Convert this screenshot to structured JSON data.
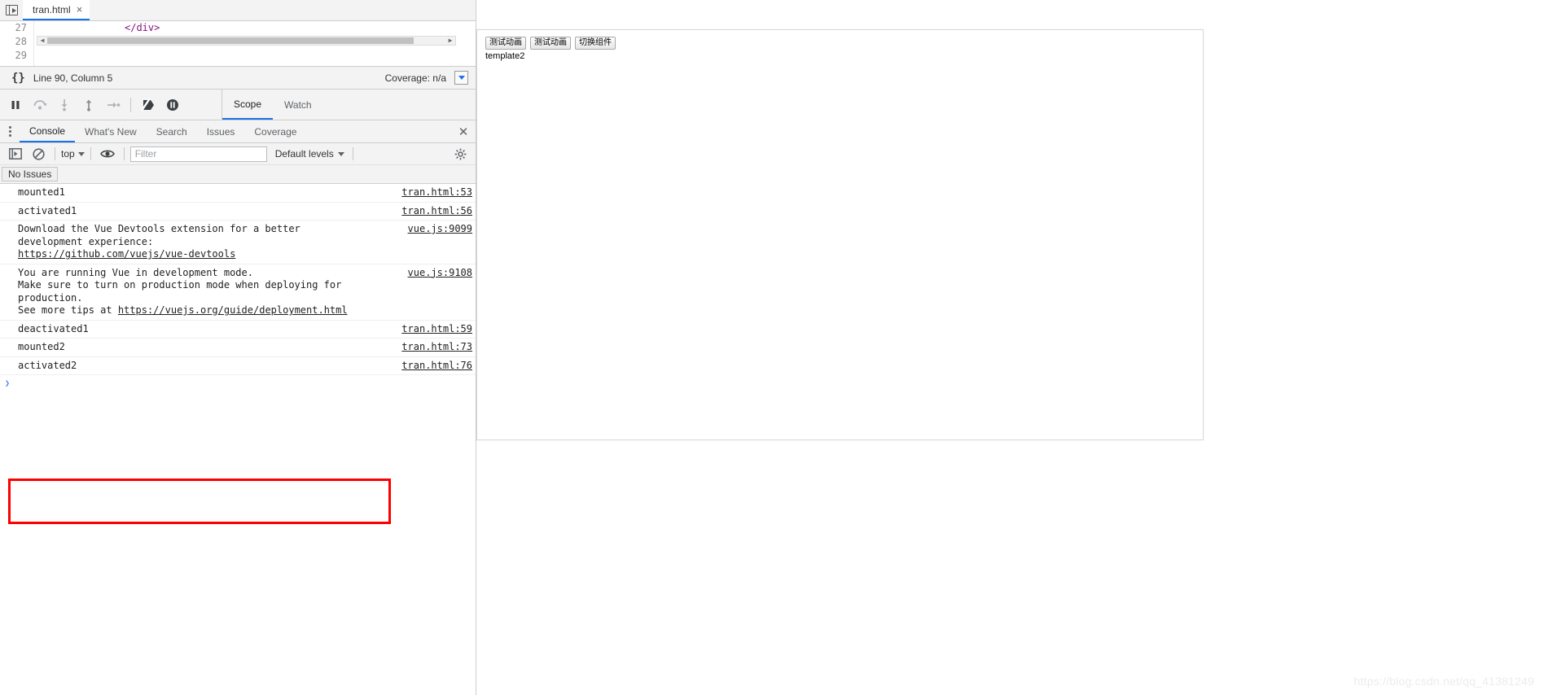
{
  "sources": {
    "file_tab": {
      "label": "tran.html",
      "close": "×"
    },
    "nav_icon": "show-navigator-icon",
    "code": {
      "lines": [
        {
          "number": "27",
          "text": "</div>"
        },
        {
          "number": "28",
          "text": ""
        },
        {
          "number": "29",
          "text": ""
        }
      ]
    },
    "status": {
      "braces": "{}",
      "position": "Line 90, Column 5",
      "coverage": "Coverage: n/a"
    }
  },
  "debugger": {
    "buttons": [
      {
        "name": "pause-script-execution",
        "glyph": "pause"
      },
      {
        "name": "step-over-next-function-call",
        "glyph": "step-over"
      },
      {
        "name": "step-into-next-function-call",
        "glyph": "step-into"
      },
      {
        "name": "step-out-of-current-function",
        "glyph": "step-out"
      },
      {
        "name": "step",
        "glyph": "step"
      },
      {
        "name": "deactivate-breakpoints",
        "glyph": "deactivate-breakpoints"
      },
      {
        "name": "pause-on-exceptions",
        "glyph": "pause-on-exceptions"
      }
    ],
    "tabs": [
      {
        "label": "Scope",
        "active": true
      },
      {
        "label": "Watch",
        "active": false
      }
    ]
  },
  "drawer": {
    "tabs": [
      {
        "label": "Console",
        "active": true
      },
      {
        "label": "What's New",
        "active": false
      },
      {
        "label": "Search",
        "active": false
      },
      {
        "label": "Issues",
        "active": false
      },
      {
        "label": "Coverage",
        "active": false
      }
    ],
    "close_label": "✕"
  },
  "console_toolbar": {
    "sidebar_toggle": "console-sidebar-icon",
    "clear": "clear-console-icon",
    "context": "top",
    "eye": "live-expression-icon",
    "filter_placeholder": "Filter",
    "filter_value": "",
    "levels": "Default levels",
    "settings": "gear-icon"
  },
  "issues": {
    "chip": "No Issues"
  },
  "console_messages": [
    {
      "text": "mounted1",
      "link": "tran.html:53",
      "highlighted": false
    },
    {
      "text": "activated1",
      "link": "tran.html:56",
      "highlighted": false
    },
    {
      "text": "Download the Vue Devtools extension for a better\ndevelopment experience:\n",
      "inline_link": "https://github.com/vuejs/vue-devtools",
      "link": "vue.js:9099",
      "highlighted": false
    },
    {
      "text": "You are running Vue in development mode.\nMake sure to turn on production mode when deploying for\nproduction.\nSee more tips at ",
      "inline_link": "https://vuejs.org/guide/deployment.html",
      "link": "vue.js:9108",
      "highlighted": false
    },
    {
      "text": "deactivated1",
      "link": "tran.html:59",
      "highlighted": true
    },
    {
      "text": "mounted2",
      "link": "tran.html:73",
      "highlighted": true
    },
    {
      "text": "activated2",
      "link": "tran.html:76",
      "highlighted": true
    }
  ],
  "console_prompt": {
    "caret": "›"
  },
  "preview": {
    "buttons": [
      {
        "label": "测试动画"
      },
      {
        "label": "测试动画"
      },
      {
        "label": "切换组件"
      }
    ],
    "content_label": "template2"
  },
  "watermark": "https://blog.csdn.net/qq_41381249",
  "colors": {
    "accent": "#1a73e8",
    "highlight": "#ff0000",
    "chrome_bg": "#f3f3f3",
    "link": "#222222"
  }
}
